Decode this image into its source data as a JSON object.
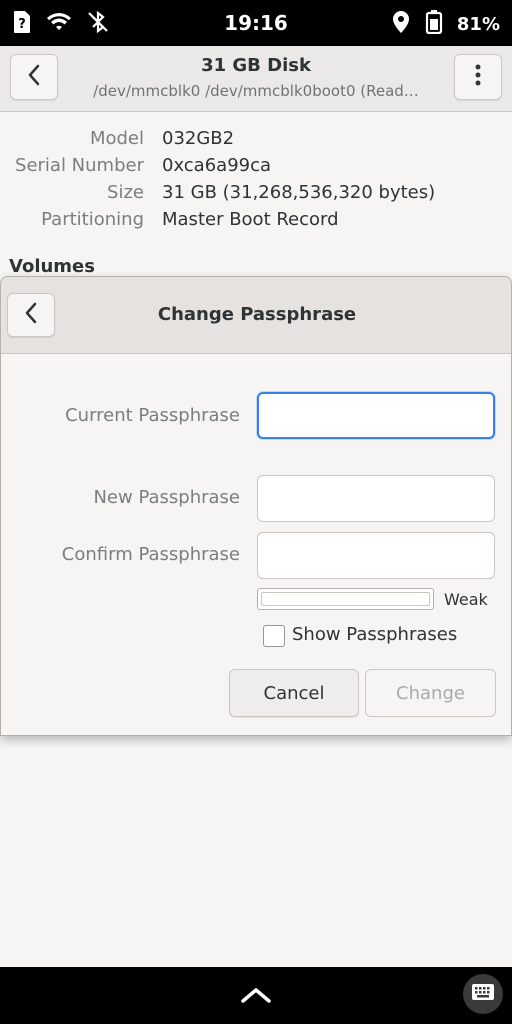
{
  "status_bar": {
    "time": "19:16",
    "battery_percent": "81%",
    "icons": [
      "unknown-sim-icon",
      "wifi-icon",
      "bluetooth-off-icon",
      "location-icon",
      "battery-icon"
    ]
  },
  "header": {
    "title": "31 GB Disk",
    "subtitle": "/dev/mmcblk0 /dev/mmcblk0boot0 (Read…"
  },
  "disk_info": {
    "rows": [
      {
        "label": "Model",
        "value": "032GB2"
      },
      {
        "label": "Serial Number",
        "value": "0xca6a99ca"
      },
      {
        "label": "Size",
        "value": "31 GB (31,268,536,320 bytes)"
      },
      {
        "label": "Partitioning",
        "value": "Master Boot Record"
      }
    ],
    "volumes_heading": "Volumes"
  },
  "dialog": {
    "title": "Change Passphrase",
    "current_label": "Current Passphrase",
    "current_value": "",
    "new_label": "New Passphrase",
    "new_value": "",
    "confirm_label": "Confirm Passphrase",
    "confirm_value": "",
    "strength_label": "Weak",
    "strength_level": 0,
    "show_passphrases_label": "Show Passphrases",
    "show_passphrases_checked": false,
    "cancel_label": "Cancel",
    "change_label": "Change"
  },
  "colors": {
    "accent": "#3584e4",
    "background": "#f6f5f4",
    "header": "#ebe9e7",
    "system_bar": "#000000"
  }
}
